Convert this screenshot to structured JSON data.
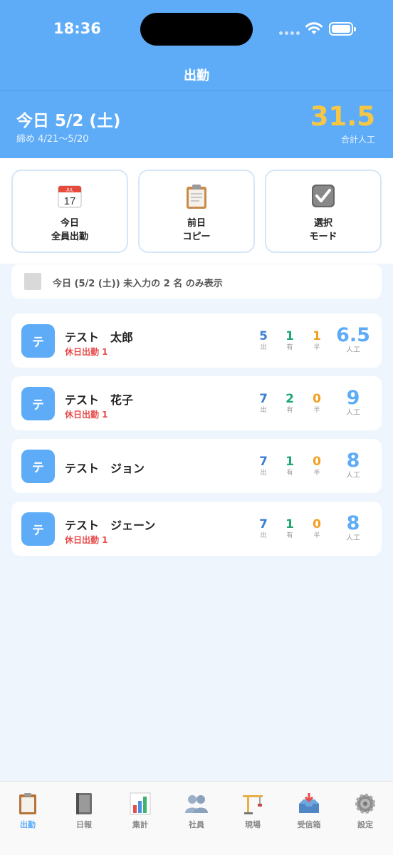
{
  "status_bar": {
    "time": "18:36"
  },
  "nav": {
    "title": "出勤"
  },
  "summary": {
    "date_title": "今日 5/2 (土)",
    "period": "締め 4/21〜5/20",
    "total_value": "31.5",
    "total_label": "合計人工"
  },
  "actions": [
    {
      "line1": "今日",
      "line2": "全員出勤",
      "icon": "calendar-icon",
      "calendar_month": "JUL",
      "calendar_day": "17"
    },
    {
      "line1": "前日",
      "line2": "コピー",
      "icon": "clipboard-icon"
    },
    {
      "line1": "選択",
      "line2": "モード",
      "icon": "checkbox-icon"
    }
  ],
  "filter": {
    "text": "今日 (5/2 (土)) 未入力の 2 名 のみ表示"
  },
  "stat_labels": {
    "work": "出",
    "paid": "有",
    "half": "半",
    "manday": "人工"
  },
  "employees": [
    {
      "initial": "テ",
      "name": "テスト　太郎",
      "note": "休日出勤 1",
      "work": "5",
      "paid": "1",
      "half": "1",
      "manday": "6.5"
    },
    {
      "initial": "テ",
      "name": "テスト　花子",
      "note": "休日出勤 1",
      "work": "7",
      "paid": "2",
      "half": "0",
      "manday": "9"
    },
    {
      "initial": "テ",
      "name": "テスト　ジョン",
      "note": "",
      "work": "7",
      "paid": "1",
      "half": "0",
      "manday": "8"
    },
    {
      "initial": "テ",
      "name": "テスト　ジェーン",
      "note": "休日出勤 1",
      "work": "7",
      "paid": "1",
      "half": "0",
      "manday": "8"
    }
  ],
  "tabs": [
    {
      "label": "出勤",
      "icon": "clipboard-icon",
      "active": true
    },
    {
      "label": "日報",
      "icon": "notebook-icon",
      "active": false
    },
    {
      "label": "集計",
      "icon": "bar-chart-icon",
      "active": false
    },
    {
      "label": "社員",
      "icon": "people-icon",
      "active": false
    },
    {
      "label": "現場",
      "icon": "crane-icon",
      "active": false
    },
    {
      "label": "受信箱",
      "icon": "inbox-icon",
      "active": false
    },
    {
      "label": "設定",
      "icon": "gear-icon",
      "active": false
    }
  ],
  "colors": {
    "primary": "#5eacf8",
    "total": "#f7c744",
    "work": "#3c7fd6",
    "paid": "#1fa672",
    "half": "#f0a020",
    "holiday": "#e84b4b"
  }
}
